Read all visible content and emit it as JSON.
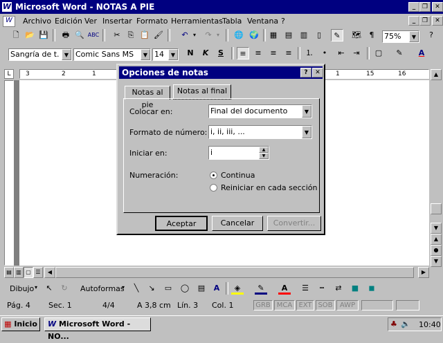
{
  "app": {
    "title": "Microsoft Word - NOTAS A PIE"
  },
  "menu": [
    "Archivo",
    "Edición",
    "Ver",
    "Insertar",
    "Formato",
    "Herramientas",
    "Tabla",
    "Ventana",
    "?"
  ],
  "format": {
    "style": "Sangría de t. ini",
    "font": "Comic Sans MS",
    "size": "14",
    "zoom": "75%"
  },
  "dialog": {
    "title": "Opciones de notas",
    "tabs": [
      "Notas al pie",
      "Notas al final"
    ],
    "active_tab": "Notas al final",
    "fields": {
      "colocar_label": "Colocar en:",
      "colocar_value": "Final del documento",
      "formato_label": "Formato de número:",
      "formato_value": "i, ii, iii, ...",
      "iniciar_label": "Iniciar en:",
      "iniciar_value": "i",
      "numeracion_label": "Numeración:",
      "radio_continua": "Continua",
      "radio_reiniciar": "Reiniciar en cada sección"
    },
    "buttons": {
      "ok": "Aceptar",
      "cancel": "Cancelar",
      "convert": "Convertir..."
    }
  },
  "drawing": {
    "dibujo": "Dibujo",
    "autoformas": "Autoformas"
  },
  "status": {
    "page": "Pág. 4",
    "section": "Sec. 1",
    "pages": "4/4",
    "position": "A 3,8 cm",
    "line": "Lín. 3",
    "col": "Col. 1",
    "modes": [
      "GRB",
      "MCA",
      "EXT",
      "SOB",
      "AWP"
    ]
  },
  "taskbar": {
    "start": "Inicio",
    "task": "Microsoft Word - NO...",
    "time": "10:40"
  },
  "ruler_numbers": [
    "3",
    "2",
    "1",
    "1",
    "15",
    "16"
  ]
}
